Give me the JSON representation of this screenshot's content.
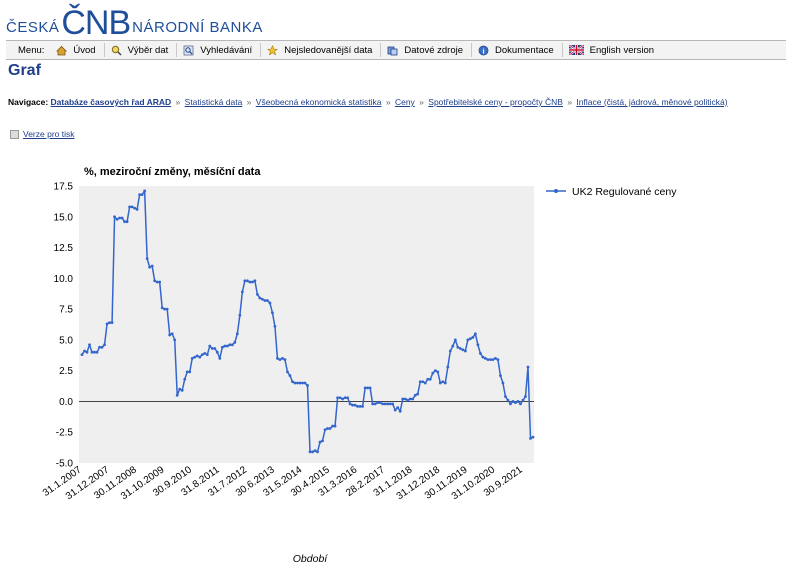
{
  "logo": {
    "left": "ČESKÁ",
    "mid": "ČNB",
    "right": "NÁRODNÍ BANKA"
  },
  "menu": {
    "label": "Menu:",
    "items": [
      {
        "label": "Úvod",
        "icon": "home-icon"
      },
      {
        "label": "Výběr dat",
        "icon": "data-select-icon"
      },
      {
        "label": "Vyhledávání",
        "icon": "search-icon"
      },
      {
        "label": "Nejsledovanější data",
        "icon": "star-icon"
      },
      {
        "label": "Datové zdroje",
        "icon": "sources-icon"
      },
      {
        "label": "Dokumentace",
        "icon": "info-icon"
      },
      {
        "label": "English version",
        "icon": "uk-flag-icon"
      }
    ]
  },
  "page_title": "Graf",
  "nav": {
    "label": "Navigace:",
    "items": [
      "Databáze časových řad ARAD",
      "Statistická data",
      "Všeobecná ekonomická statistika",
      "Ceny",
      "Spotřebitelské ceny - propočty ČNB",
      "Inflace (čistá, jádrová, měnové politická)"
    ]
  },
  "print_link": "Verze pro tisk",
  "chart_data": {
    "type": "line",
    "title": "%, meziroční změny, měsíční data",
    "xlabel": "Období",
    "ylabel": "",
    "ylim": [
      -5.0,
      17.5
    ],
    "yticks": [
      "17.5",
      "15.0",
      "12.5",
      "10.0",
      "7.5",
      "5.0",
      "2.5",
      "0.0",
      "-2.5",
      "-5.0"
    ],
    "xticks": [
      "31.1.2007",
      "31.12.2007",
      "30.11.2008",
      "31.10.2009",
      "30.9.2010",
      "31.8.2011",
      "31.7.2012",
      "30.6.2013",
      "31.5.2014",
      "30.4.2015",
      "31.3.2016",
      "28.2.2017",
      "31.1.2018",
      "31.12.2018",
      "30.11.2019",
      "31.10.2020",
      "30.9.2021"
    ],
    "grid": false,
    "legend": "top-right",
    "color": "#3366cc",
    "series": [
      {
        "name": "UK2 Regulované ceny",
        "values": [
          3.8,
          4.1,
          4.0,
          4.6,
          4.0,
          4.0,
          4.0,
          4.4,
          4.4,
          4.6,
          6.3,
          6.4,
          6.4,
          15.0,
          14.8,
          14.9,
          14.9,
          14.6,
          14.6,
          15.8,
          15.8,
          15.7,
          15.6,
          16.8,
          16.8,
          17.1,
          11.6,
          10.9,
          11.0,
          9.8,
          9.7,
          9.7,
          7.6,
          7.5,
          7.5,
          5.4,
          5.5,
          5.0,
          0.5,
          1.0,
          0.9,
          1.8,
          2.4,
          2.4,
          3.5,
          3.6,
          3.7,
          3.6,
          3.8,
          3.9,
          3.8,
          4.5,
          4.3,
          4.3,
          4.0,
          3.5,
          4.4,
          4.5,
          4.5,
          4.6,
          4.6,
          4.8,
          5.5,
          7.0,
          8.9,
          9.8,
          9.8,
          9.7,
          9.7,
          9.8,
          8.7,
          8.4,
          8.3,
          8.2,
          8.2,
          8.0,
          7.2,
          6.1,
          3.5,
          3.4,
          3.5,
          3.4,
          2.4,
          2.1,
          1.6,
          1.5,
          1.5,
          1.5,
          1.5,
          1.5,
          1.3,
          -4.1,
          -4.1,
          -4.0,
          -4.1,
          -3.3,
          -3.2,
          -2.3,
          -2.2,
          -2.2,
          -2.0,
          -2.0,
          0.3,
          0.3,
          0.2,
          0.3,
          0.3,
          -0.2,
          -0.3,
          -0.3,
          -0.4,
          -0.4,
          -0.4,
          1.1,
          1.1,
          1.1,
          -0.2,
          -0.2,
          -0.1,
          -0.1,
          -0.2,
          -0.2,
          -0.2,
          -0.2,
          -0.2,
          -0.7,
          -0.5,
          -0.8,
          0.2,
          0.2,
          0.1,
          0.2,
          0.2,
          0.5,
          0.6,
          1.6,
          1.6,
          1.5,
          1.8,
          1.8,
          2.3,
          2.5,
          2.4,
          1.5,
          1.6,
          1.5,
          2.8,
          4.1,
          4.5,
          5.0,
          4.4,
          4.3,
          4.2,
          4.1,
          5.0,
          5.1,
          5.2,
          5.5,
          4.6,
          3.9,
          3.6,
          3.5,
          3.4,
          3.4,
          3.4,
          3.5,
          3.4,
          2.1,
          1.5,
          0.4,
          0.1,
          -0.2,
          0.0,
          -0.1,
          0.0,
          -0.2,
          0.1,
          0.4,
          2.8,
          -3.0,
          -2.9
        ]
      }
    ]
  }
}
